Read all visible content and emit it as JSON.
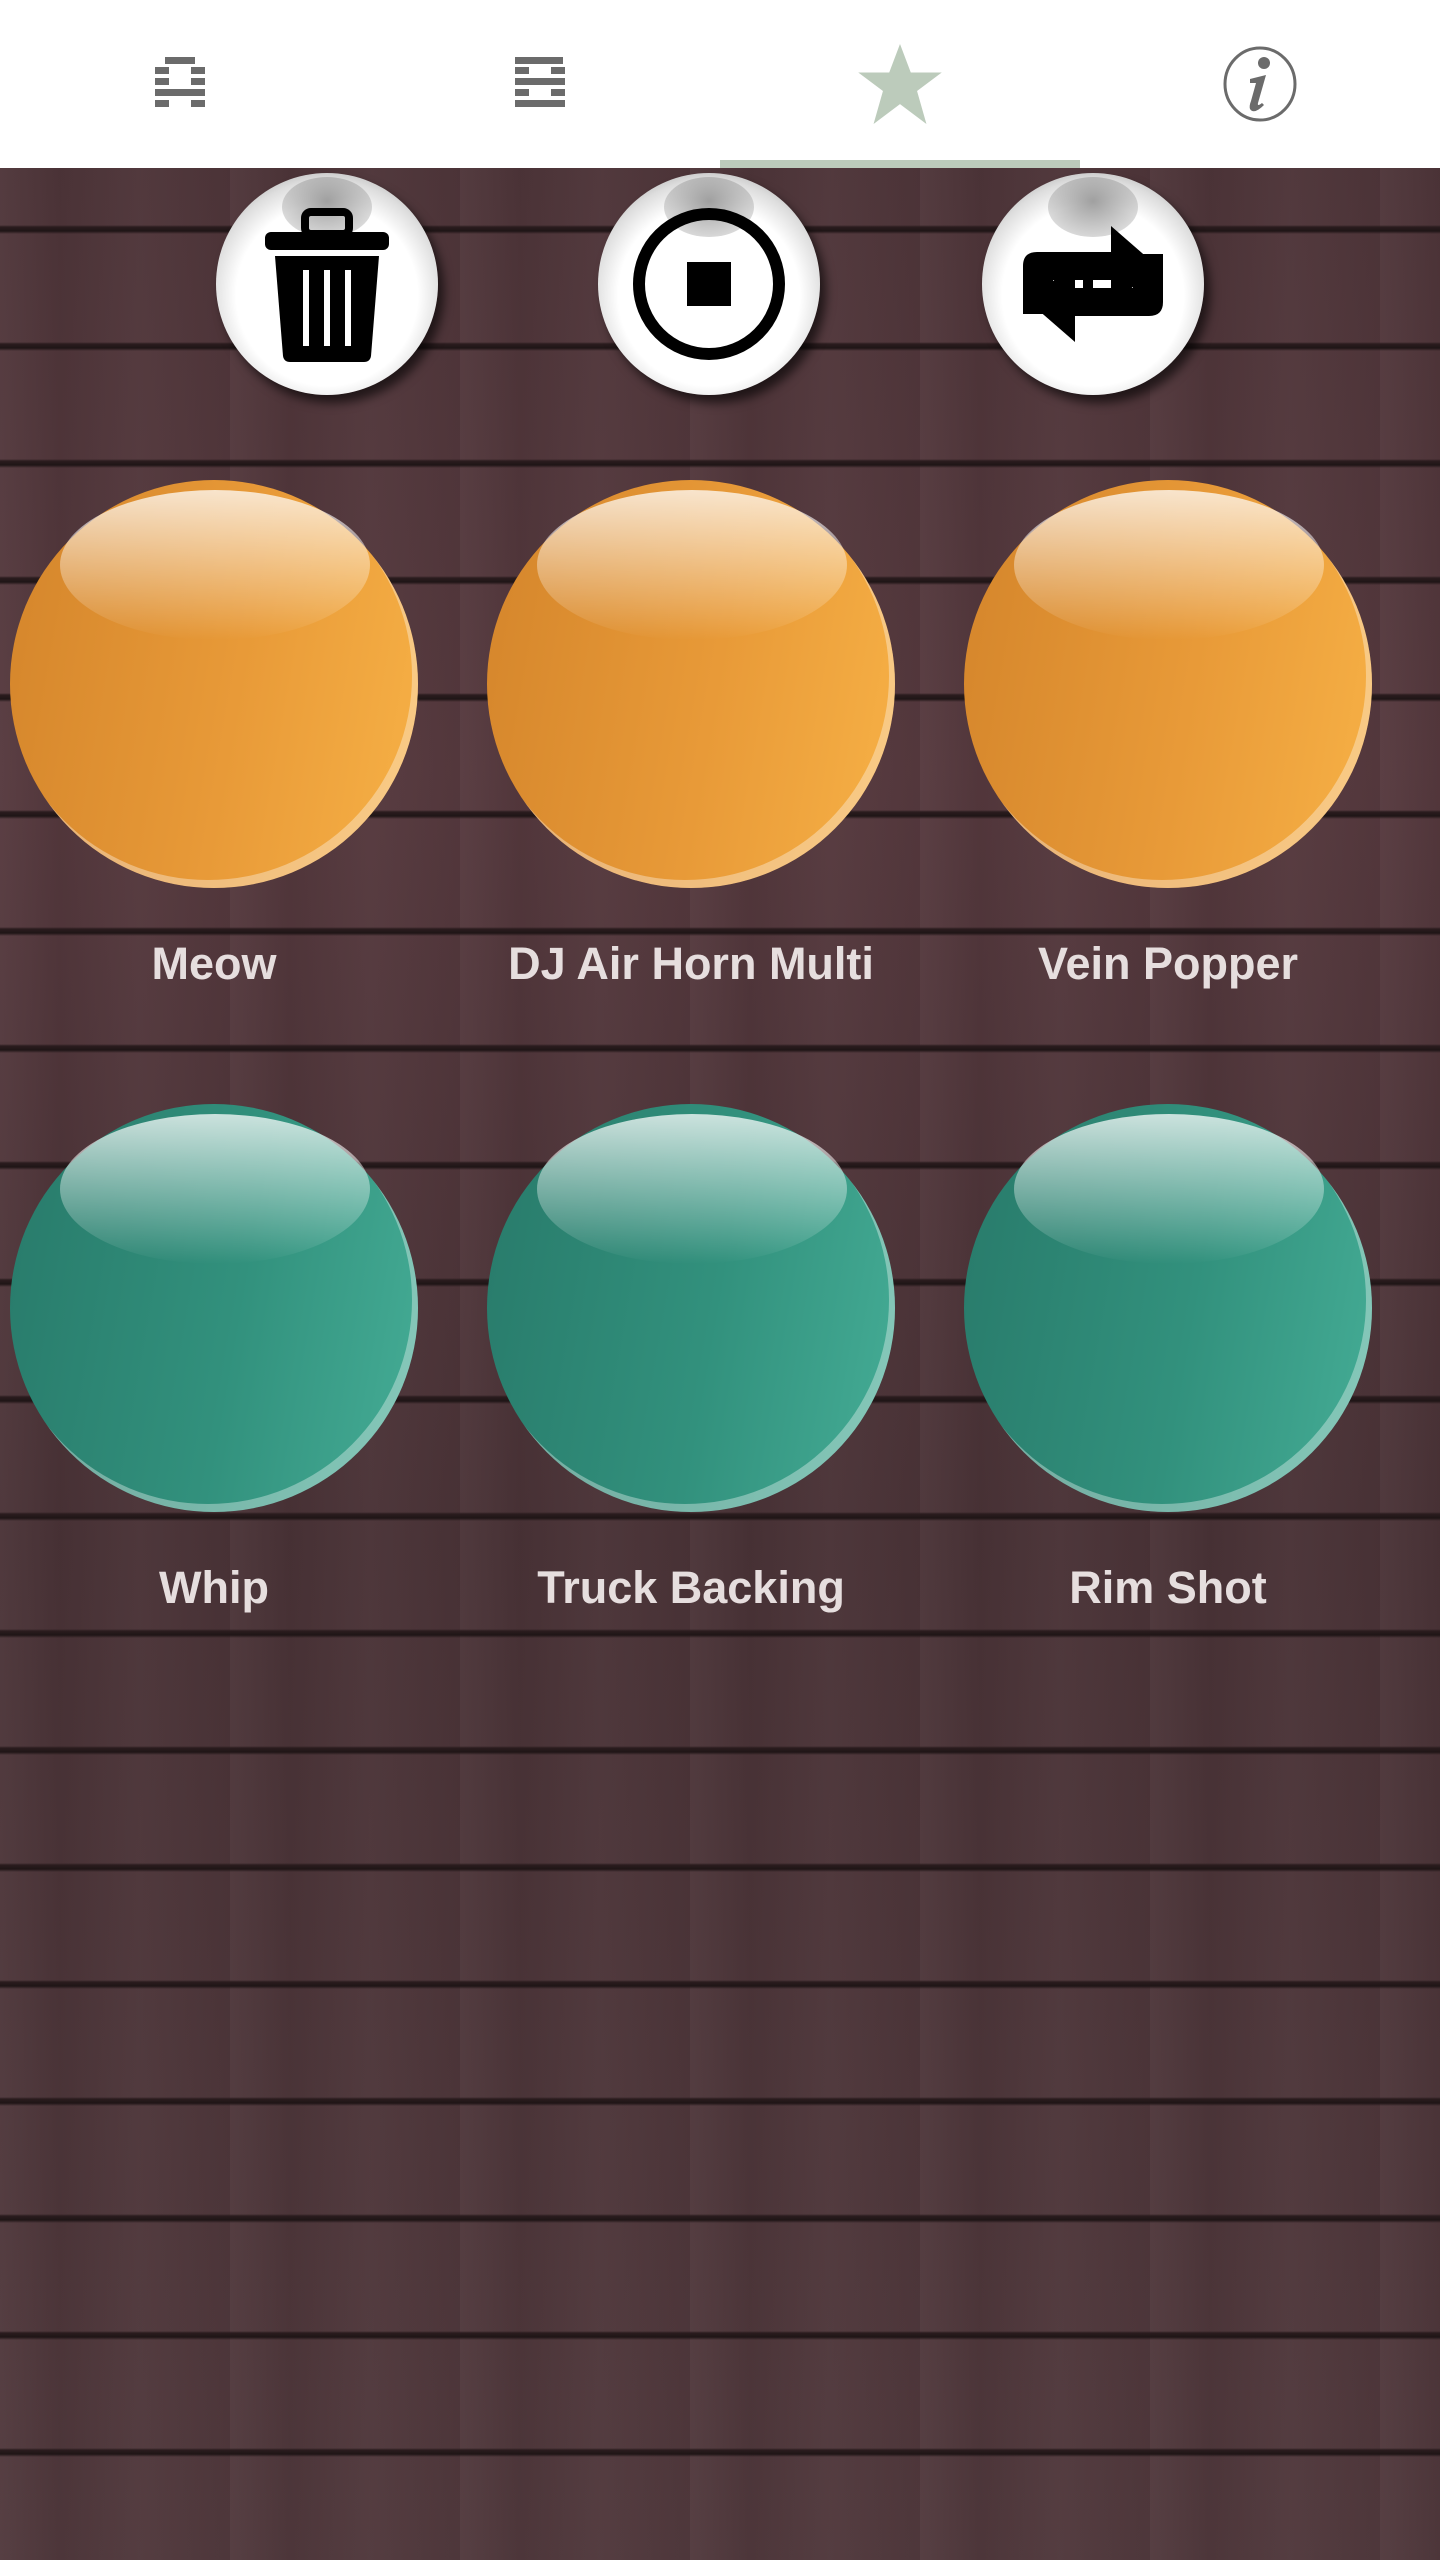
{
  "tabs": [
    {
      "icon": "letter-a-icon",
      "active": false
    },
    {
      "icon": "letter-b-icon",
      "active": false
    },
    {
      "icon": "star-icon",
      "active": true
    },
    {
      "icon": "info-icon",
      "active": false
    }
  ],
  "colors": {
    "tab_icon": "#6b6b6b",
    "tab_active": "#bccbbb",
    "orange": "#e89a38",
    "teal": "#32917d",
    "label": "#e6dede"
  },
  "actions": [
    {
      "icon": "trash-icon"
    },
    {
      "icon": "stop-icon"
    },
    {
      "icon": "repeat-icon"
    }
  ],
  "sounds": [
    {
      "label": "Meow",
      "color": "orange"
    },
    {
      "label": "DJ Air Horn Multi",
      "color": "orange"
    },
    {
      "label": "Vein Popper",
      "color": "orange"
    },
    {
      "label": "Whip",
      "color": "teal"
    },
    {
      "label": "Truck Backing",
      "color": "teal"
    },
    {
      "label": "Rim Shot",
      "color": "teal"
    }
  ]
}
